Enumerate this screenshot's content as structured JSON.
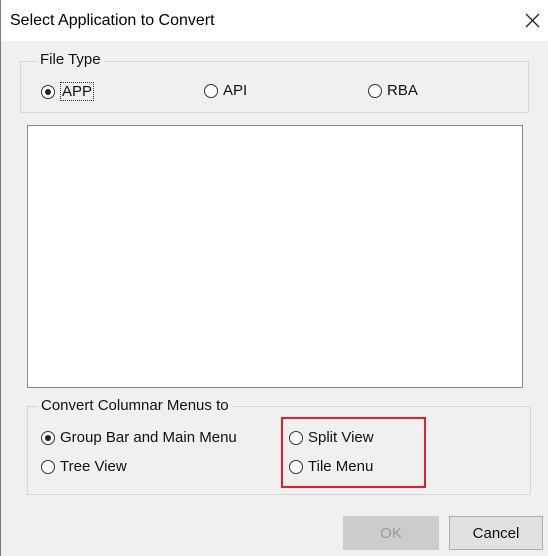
{
  "window": {
    "title": "Select Application to Convert",
    "close_icon": "close-icon"
  },
  "file_type": {
    "label": "File Type",
    "options": [
      {
        "label": "APP",
        "checked": true
      },
      {
        "label": "API",
        "checked": false
      },
      {
        "label": "RBA",
        "checked": false
      }
    ]
  },
  "application_list": {
    "items": []
  },
  "convert_menus": {
    "label": "Convert Columnar Menus to",
    "options": [
      {
        "label": "Group Bar and Main Menu",
        "checked": true
      },
      {
        "label": "Split View",
        "checked": false
      },
      {
        "label": "Tree View",
        "checked": false
      },
      {
        "label": "Tile Menu",
        "checked": false
      }
    ]
  },
  "buttons": {
    "ok": "OK",
    "cancel": "Cancel"
  },
  "colors": {
    "highlight": "#e0202a",
    "dialog_background": "#f0f0f0"
  }
}
